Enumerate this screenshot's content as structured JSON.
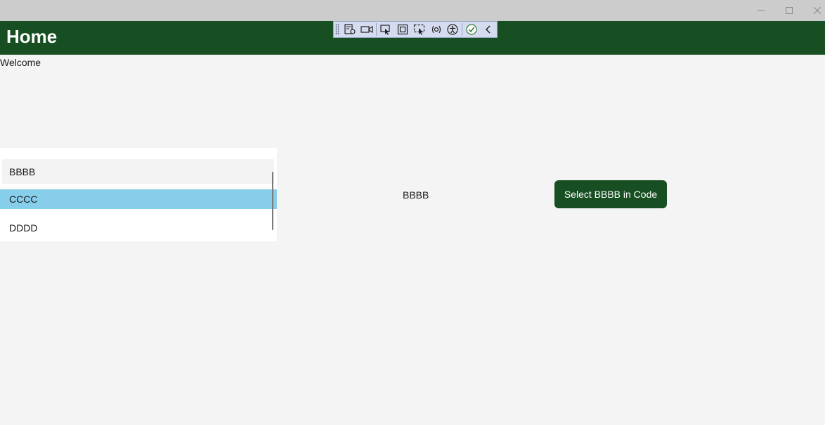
{
  "header": {
    "title": "Home"
  },
  "welcome_text": "Welcome",
  "list": {
    "items": [
      {
        "label": "BBBB",
        "state": "hover"
      },
      {
        "label": "CCCC",
        "state": "selected"
      },
      {
        "label": "DDDD",
        "state": "normal"
      }
    ]
  },
  "selected_display": "BBBB",
  "button": {
    "label": "Select BBBB in Code"
  },
  "colors": {
    "titlebar": "#cccccc",
    "header": "#174f22",
    "page_background": "#f4f4f4",
    "selected_item": "#87ceeb",
    "button": "#174f22"
  },
  "toolbar_icons": [
    "live-visual-tree-icon",
    "camera-icon",
    "select-element-icon",
    "display-layout-adorners-icon",
    "track-focus-icon",
    "binding-failures-icon",
    "accessibility-icon",
    "check-icon",
    "collapse-chevron-icon"
  ]
}
